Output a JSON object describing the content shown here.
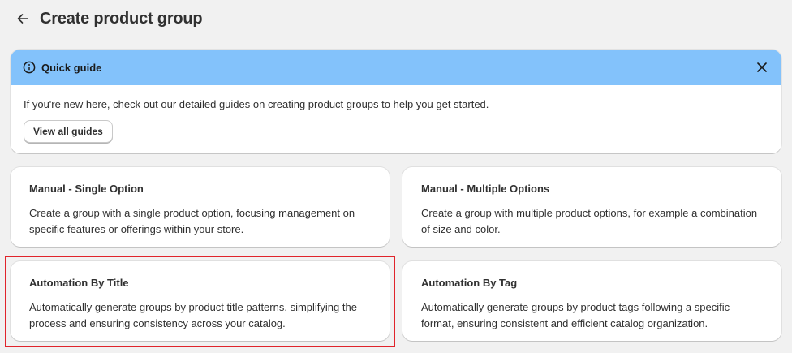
{
  "header": {
    "title": "Create product group",
    "back_icon": "arrow-left-icon"
  },
  "guide": {
    "title": "Quick guide",
    "text": "If you're new here, check out our detailed guides on creating product groups to help you get started.",
    "button_label": "View all guides",
    "banner_color": "#83c2fb"
  },
  "cards": [
    {
      "title": "Manual - Single Option",
      "description": "Create a group with a single product option, focusing management on specific features or offerings within your store."
    },
    {
      "title": "Manual - Multiple Options",
      "description": "Create a group with multiple product options, for example a combination of size and color."
    },
    {
      "title": "Automation By Title",
      "description": "Automatically generate groups by product title patterns, simplifying the process and ensuring consistency across your catalog."
    },
    {
      "title": "Automation By Tag",
      "description": "Automatically generate groups by product tags following a specific format, ensuring consistent and efficient catalog organization."
    }
  ],
  "highlight_color": "#e0242b"
}
